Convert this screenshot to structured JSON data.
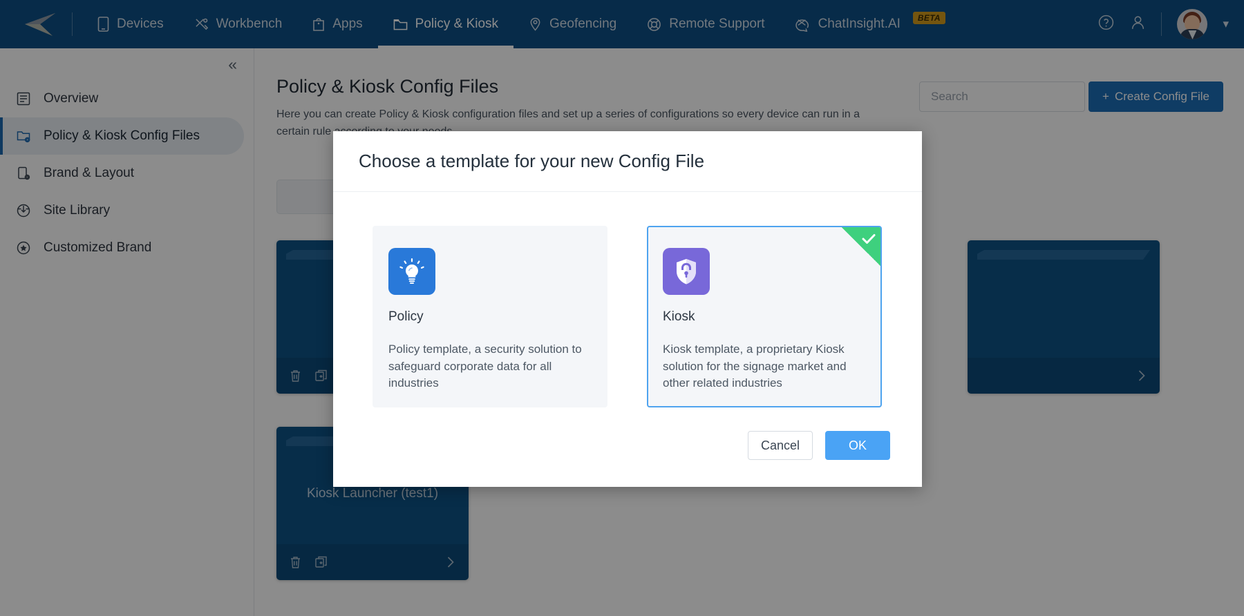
{
  "topnav": {
    "logo_name": "back-arrow-logo",
    "items": [
      {
        "label": "Devices",
        "icon": "phone-icon",
        "active": false
      },
      {
        "label": "Workbench",
        "icon": "tools-icon",
        "active": false
      },
      {
        "label": "Apps",
        "icon": "bag-icon",
        "active": false
      },
      {
        "label": "Policy & Kiosk",
        "icon": "folder-icon",
        "active": true
      },
      {
        "label": "Geofencing",
        "icon": "location-pin-icon",
        "active": false
      },
      {
        "label": "Remote Support",
        "icon": "lifebuoy-icon",
        "active": false
      },
      {
        "label": "ChatInsight.AI",
        "icon": "chat-ai-icon",
        "active": false,
        "badge": "BETA"
      }
    ],
    "help_icon": "question-circle-icon",
    "account_icon": "user-circle-icon",
    "avatar": "user-avatar",
    "caret": "chevron-down-icon"
  },
  "sidebar": {
    "collapse_icon": "collapse-double-chevron-left",
    "items": [
      {
        "label": "Overview",
        "icon": "document-list-icon",
        "active": false
      },
      {
        "label": "Policy & Kiosk Config Files",
        "icon": "folder-settings-icon",
        "active": true
      },
      {
        "label": "Brand & Layout",
        "icon": "device-settings-icon",
        "active": false
      },
      {
        "label": "Site Library",
        "icon": "globe-download-icon",
        "active": false
      },
      {
        "label": "Customized Brand",
        "icon": "star-circle-icon",
        "active": false
      }
    ]
  },
  "page": {
    "title": "Policy & Kiosk Config Files",
    "subtitle": "Here you can create Policy & Kiosk configuration files and set up a series of configurations so every device can run in a certain rule according to your needs.",
    "search_placeholder": "Search",
    "search_value": "",
    "search_icon": "search-icon",
    "create_button_label": "Create Config File",
    "create_button_icon": "plus-icon"
  },
  "config_cards": [
    {
      "name": "",
      "icons": [
        "trash-icon",
        "duplicate-icon"
      ],
      "chevron": "chevron-right-icon"
    },
    {
      "name": "",
      "icons": [],
      "chevron": "chevron-right-icon"
    },
    {
      "name": "Kiosk Launcher (test1)",
      "icons": [
        "trash-icon",
        "duplicate-icon"
      ],
      "chevron": "chevron-right-icon"
    }
  ],
  "modal": {
    "title": "Choose a template for your new Config File",
    "templates": [
      {
        "name": "Policy",
        "icon": "lightbulb-icon",
        "icon_color": "#2979d9",
        "description": "Policy template, a security solution to safeguard corporate data for all industries",
        "selected": false
      },
      {
        "name": "Kiosk",
        "icon": "shield-lock-icon",
        "icon_color": "#7868d9",
        "description": "Kiosk template, a proprietary Kiosk solution for the signage market and other related industries",
        "selected": true
      }
    ],
    "selected_badge_icon": "check-icon",
    "selected_badge_color": "#3ed07e",
    "cancel_label": "Cancel",
    "ok_label": "OK"
  },
  "colors": {
    "nav_blue": "#0e4f85",
    "accent_blue": "#1d6eb7",
    "primary_button": "#4aa3f5",
    "card_blue": "#0e5286",
    "selected_border": "#4ea3ef"
  }
}
